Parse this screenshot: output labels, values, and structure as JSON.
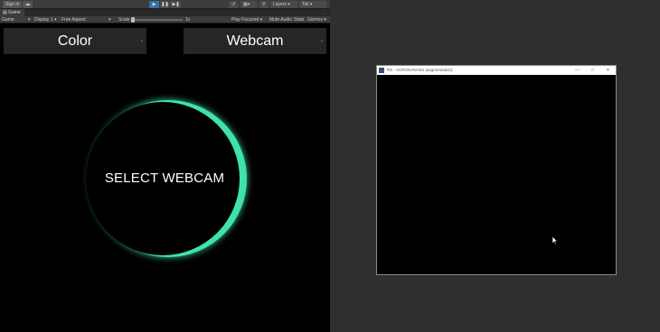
{
  "toolbar": {
    "sign_in": "Sign in",
    "cloud_icon": "cloud-icon",
    "play_icon": "▶",
    "pause_icon": "❚❚",
    "step_icon": "▶❚",
    "layers_label": "Layers",
    "layout_label": "Tall",
    "accent_color": "#3a6ea8"
  },
  "game_tab": {
    "label": "Game"
  },
  "game_bar": {
    "view_select": "Game",
    "display": "Display 1",
    "aspect": "Free Aspect",
    "scale_label": "Scale",
    "scale_value": "1x",
    "play_mode": "Play Focused",
    "mute": "Mute Audio",
    "stats": "Stats",
    "gizmos": "Gizmos"
  },
  "game_view": {
    "color_dropdown": "Color",
    "webcam_dropdown": "Webcam",
    "select_webcam": "SELECT WEBCAM",
    "glow_color": "#3fe3a8"
  },
  "popup_window": {
    "title": "RS - ACRONYM-W1 (segmentation)"
  }
}
